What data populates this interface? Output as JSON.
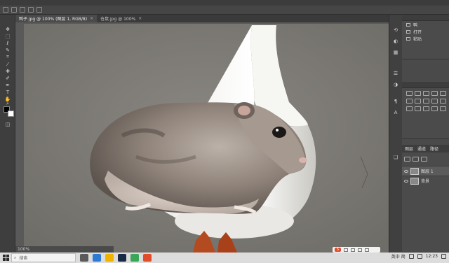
{
  "app": {
    "name": "Photoshop"
  },
  "tabs": [
    {
      "label": "鸭子.jpg @ 100% (图层 1, RGB/8)",
      "active": true
    },
    {
      "label": "仓鼠.jpg @ 100%",
      "active": false
    }
  ],
  "status": {
    "zoom": "100%"
  },
  "history_panel": {
    "items": [
      {
        "label": "鸭"
      },
      {
        "label": "打开"
      },
      {
        "label": "粘贴"
      }
    ]
  },
  "layers_panel": {
    "tabs": [
      "图层",
      "通道",
      "路径"
    ],
    "layers": [
      {
        "name": "图层 1",
        "selected": true
      },
      {
        "name": "背景",
        "selected": false
      }
    ]
  },
  "taskbar": {
    "search_placeholder": "搜索",
    "tray_time": "12:23",
    "tray_label": "英中 简"
  },
  "floating_toolbar": {
    "logo": "S"
  },
  "colors": {
    "accent": "#e04b2b",
    "panel": "#4a4a4a",
    "canvas_ground": "#7d7b76"
  }
}
